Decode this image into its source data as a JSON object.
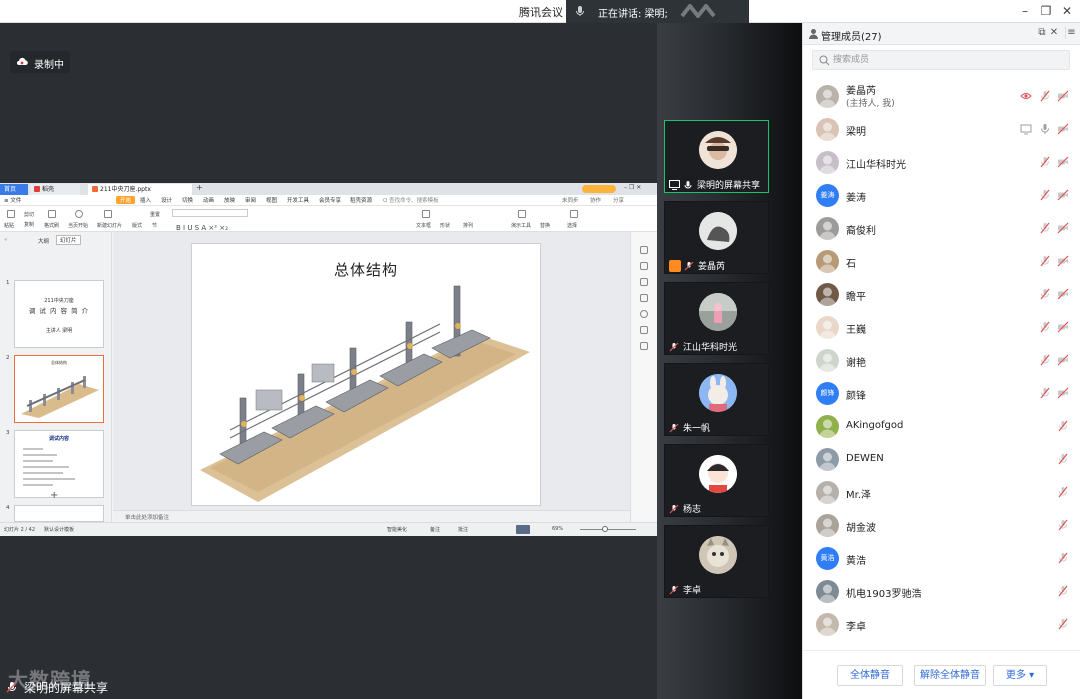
{
  "window": {
    "app_title": "腾讯会议",
    "speaking_label": "正在讲话: 梁明;",
    "controls": {
      "minimize": "–",
      "maximize": "❐",
      "close": "✕"
    }
  },
  "recording": {
    "label": "录制中"
  },
  "shared_screen": {
    "tabs": [
      {
        "label": "首页"
      },
      {
        "label": "稻壳"
      },
      {
        "label": "211中央刀座.pptx"
      }
    ],
    "menu": [
      "≡ 文件",
      "开始",
      "插入",
      "设计",
      "切换",
      "动画",
      "放映",
      "审阅",
      "视图",
      "开发工具",
      "会员专享",
      "稻壳资源",
      "Q 查找命令、搜索模板"
    ],
    "menu_right": [
      "未同步",
      "协作",
      "分享"
    ],
    "ribbon": [
      "粘贴",
      "剪切",
      "复制",
      "格式刷",
      "当页开始",
      "新建幻灯片",
      "版式",
      "节",
      "重置",
      "文本框",
      "形状",
      "排列",
      "演示工具",
      "替换",
      "选择"
    ],
    "left_tabs": [
      "大纲",
      "幻灯片"
    ],
    "thumbnails": [
      {
        "num": "1",
        "lines": [
          "211中央刀座",
          "调 试 内 容 简 介",
          "主讲人    梁明"
        ]
      },
      {
        "num": "2",
        "lines": [
          "总体结构"
        ]
      },
      {
        "num": "3",
        "lines": [
          "调试内容"
        ]
      },
      {
        "num": "4",
        "lines": []
      }
    ],
    "slide_title": "总体结构",
    "note_placeholder": "单击此处添加备注",
    "status_left": "幻灯片 2 / 42",
    "status_theme": "默认设计模板",
    "status_right": [
      "智能美化",
      "备注",
      "批注",
      "69%"
    ]
  },
  "share_footer": {
    "label": "梁明的屏幕共享"
  },
  "watermark": "大数跨境",
  "video_tiles": [
    {
      "name": "梁明的屏幕共享",
      "active": true,
      "sharing": true
    },
    {
      "name": "姜晶芮",
      "active": false,
      "sharing": false
    },
    {
      "name": "江山华科时光",
      "active": false,
      "sharing": false
    },
    {
      "name": "朱一帆",
      "active": false,
      "sharing": false
    },
    {
      "name": "杨志",
      "active": false,
      "sharing": false
    },
    {
      "name": "李卓",
      "active": false,
      "sharing": false
    }
  ],
  "members_panel": {
    "title": "管理成员(27)",
    "search_placeholder": "搜索成员",
    "members": [
      {
        "name": "姜晶芮",
        "sub": "(主持人, 我)",
        "avatar_text": "",
        "avatar_style": "photo",
        "state": "muted-video"
      },
      {
        "name": "梁明",
        "sub": "",
        "avatar_text": "",
        "avatar_style": "photo",
        "state": "speaking"
      },
      {
        "name": "江山华科时光",
        "sub": "",
        "avatar_text": "",
        "avatar_style": "photo",
        "state": "muted-video"
      },
      {
        "name": "姜涛",
        "sub": "",
        "avatar_text": "姜涛",
        "avatar_style": "blue",
        "state": "muted-video"
      },
      {
        "name": "裔俊利",
        "sub": "",
        "avatar_text": "",
        "avatar_style": "photo",
        "state": "muted-video"
      },
      {
        "name": "石",
        "sub": "",
        "avatar_text": "",
        "avatar_style": "photo",
        "state": "muted-video"
      },
      {
        "name": "瞻平",
        "sub": "",
        "avatar_text": "",
        "avatar_style": "photo",
        "state": "muted-video"
      },
      {
        "name": "王巍",
        "sub": "",
        "avatar_text": "",
        "avatar_style": "photo",
        "state": "muted-video"
      },
      {
        "name": "谢艳",
        "sub": "",
        "avatar_text": "",
        "avatar_style": "photo",
        "state": "muted-video"
      },
      {
        "name": "颜锋",
        "sub": "",
        "avatar_text": "颜锋",
        "avatar_style": "blue",
        "state": "muted-video"
      },
      {
        "name": "AKingofgod",
        "sub": "",
        "avatar_text": "",
        "avatar_style": "photo",
        "state": "muted"
      },
      {
        "name": "DEWEN",
        "sub": "",
        "avatar_text": "",
        "avatar_style": "photo",
        "state": "muted"
      },
      {
        "name": "Mr.泽",
        "sub": "",
        "avatar_text": "",
        "avatar_style": "photo",
        "state": "muted"
      },
      {
        "name": "胡金波",
        "sub": "",
        "avatar_text": "",
        "avatar_style": "photo",
        "state": "muted"
      },
      {
        "name": "黄浩",
        "sub": "",
        "avatar_text": "黄浩",
        "avatar_style": "blue",
        "state": "muted"
      },
      {
        "name": "机电1903罗驰浩",
        "sub": "",
        "avatar_text": "",
        "avatar_style": "photo",
        "state": "muted"
      },
      {
        "name": "李卓",
        "sub": "",
        "avatar_text": "",
        "avatar_style": "photo",
        "state": "muted"
      }
    ],
    "footer_buttons": [
      "全体静音",
      "解除全体静音",
      "更多 ▾"
    ]
  },
  "colors": {
    "accent_green": "#19c36b",
    "muted_red": "#e05555",
    "link_blue": "#2f6bd8",
    "avatar_blue": "#2f7ef6"
  }
}
